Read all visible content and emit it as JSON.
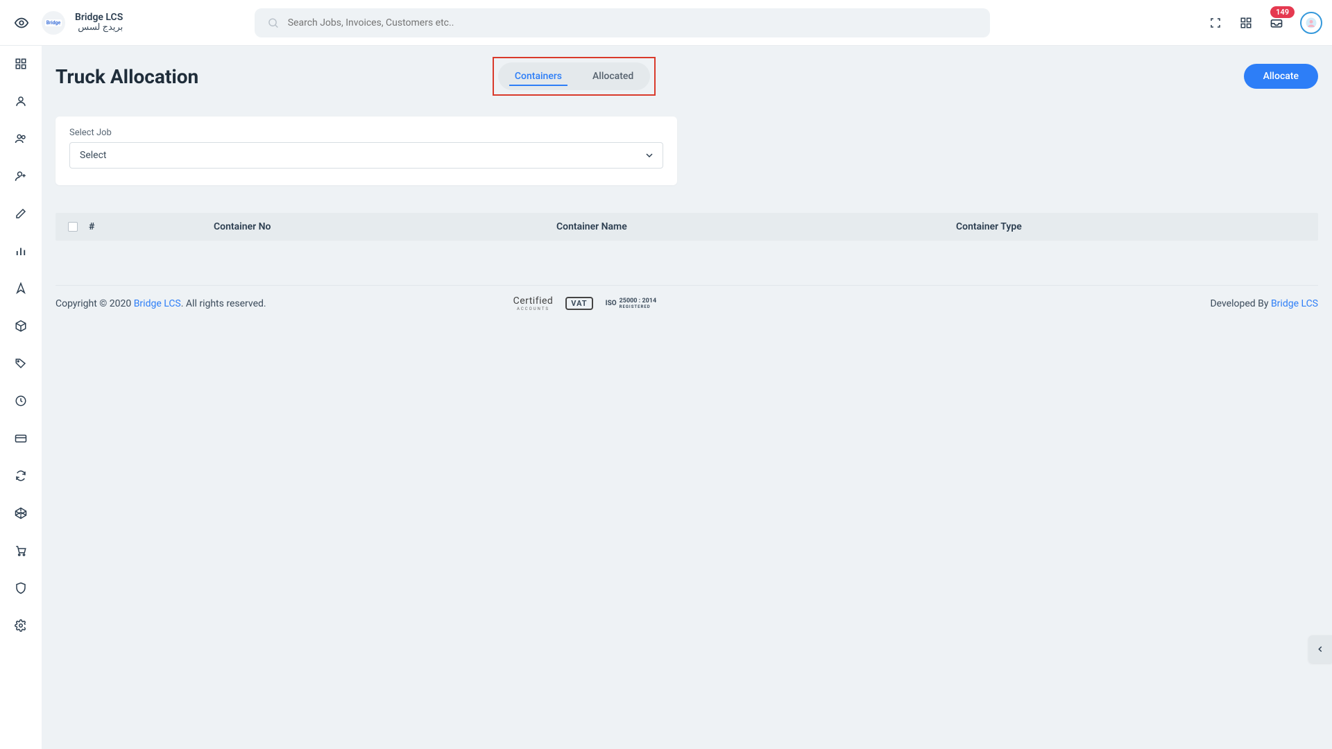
{
  "brand": {
    "en": "Bridge LCS",
    "ar": "بريدج لسس",
    "logo": "Bridge"
  },
  "search": {
    "placeholder": "Search Jobs, Invoices, Customers etc.."
  },
  "notif": {
    "count": "149"
  },
  "page": {
    "title": "Truck Allocation"
  },
  "tabs": {
    "containers": "Containers",
    "allocated": "Allocated"
  },
  "buttons": {
    "allocate": "Allocate"
  },
  "card": {
    "label": "Select Job",
    "select_placeholder": "Select"
  },
  "table": {
    "h_num": "#",
    "h_no": "Container No",
    "h_name": "Container Name",
    "h_type": "Container Type"
  },
  "footer": {
    "copyright_pre": "Copyright © 2020 ",
    "brand_link": "Bridge LCS",
    "copyright_post": ". All rights reserved.",
    "certified": "Certified",
    "certified_sub": "ACCOUNTS",
    "vat": "VAT",
    "iso": "ISO",
    "iso_num": "25000 : 2014",
    "iso_sub": "REGISTERED",
    "dev_pre": "Developed By ",
    "dev_link": "Bridge LCS"
  }
}
